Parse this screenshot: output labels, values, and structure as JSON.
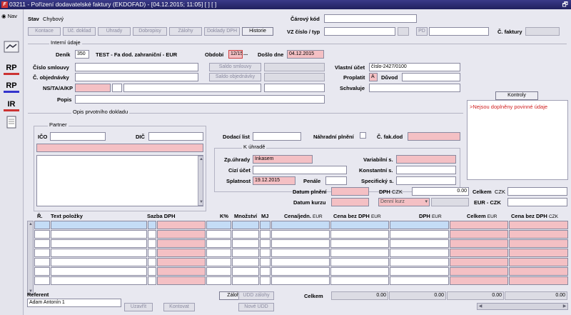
{
  "window": {
    "title": "03211 - Pořízení dodavatelské faktury (EKDOFAD) - [04.12.2015; 11:05] [ ] [ ]",
    "app_icon": "F"
  },
  "sidebar": {
    "nav_label": "Nav",
    "icons": [
      "handshake-icon",
      "RP",
      "RP",
      "IR",
      "document-icon"
    ]
  },
  "header": {
    "stav_label": "Stav",
    "stav_value": "Chybový",
    "carovy_kod_label": "Čárový kód",
    "carovy_kod_value": "",
    "vz_label": "VZ číslo / typ",
    "vz_value": "",
    "vz_typ": "",
    "pd_label": "PD",
    "pd_value": "",
    "c_faktury_label": "Č. faktury",
    "c_faktury_value": "",
    "buttons": [
      "Kontace",
      "Úč. doklad",
      "Úhrady",
      "Dobropisy",
      "Zálohy",
      "Doklady DPH",
      "Historie"
    ]
  },
  "interni": {
    "title": "Interní údaje",
    "denik_label": "Deník",
    "denik_value": "350",
    "denik_name": "TEST - Fa dod. zahraniční - EUR",
    "obdobi_label": "Období",
    "obdobi_value": "12/15",
    "obdobi_dots": "...",
    "doslo_label": "Došlo dne",
    "doslo_value": "04.12.2015",
    "cislo_smlouvy_label": "Číslo smlouvy",
    "cislo_smlouvy_value": "",
    "saldo_smlouvy_btn": "Saldo smlouvy",
    "saldo_smlouvy_value": "",
    "c_objednavky_label": "Č. objednávky",
    "c_objednavky_value": "",
    "saldo_objednavky_btn": "Saldo objednávky",
    "saldo_objednavky_value": "",
    "ns_label": "NS/TA/A/KP",
    "popis_label": "Popis",
    "popis_value": "",
    "vlastni_ucet_label": "Vlastní účet",
    "vlastni_ucet_value": "číslo-2427/0100",
    "proplatit_label": "Proplatit",
    "proplatit_value": "A",
    "duvod_label": "Důvod",
    "duvod_value": "",
    "schvaluje_label": "Schvaluje",
    "schvaluje_value": ""
  },
  "kontroly": {
    "button": "Kontroly",
    "message": ">Nejsou doplněny povinné údaje"
  },
  "opis": {
    "title": "Opis prvotního dokladu",
    "partner_title": "Partner",
    "ico_label": "IČO",
    "ico_value": "",
    "dic_label": "DIČ",
    "dic_value": "",
    "dodaci_list_label": "Dodací list",
    "dodaci_list_value": "",
    "nahradni_plneni_label": "Náhradní plnění",
    "c_fak_dod_label": "Č. fak.dod",
    "c_fak_dod_value": "",
    "k_uhrade_title": "K úhradě",
    "zp_uhrady_label": "Zp.úhrady",
    "zp_uhrady_value": "Inkasem",
    "cizi_ucet_label": "Cizí účet",
    "cizi_ucet_value": "",
    "splatnost_label": "Splatnost",
    "splatnost_value": "19.12.2015",
    "penale_label": "Penále",
    "penale_value": "",
    "variabilni_label": "Variabilní s.",
    "variabilni_value": "",
    "konstantni_label": "Konstantní s.",
    "konstantni_value": "",
    "specificky_label": "Specifický s.",
    "specificky_value": ""
  },
  "datumy": {
    "plneni_label": "Datum plnění",
    "plneni_value": "",
    "kurzu_label": "Datum kurzu",
    "kurzu_value": "",
    "dph_label": "DPH",
    "dph_currency": "CZK",
    "dph_value": "0.00",
    "denni_kurz": "Denní kurz",
    "celkem_label": "Celkem",
    "celkem_currency": "CZK",
    "celkem_value": "",
    "eur_czk_label": "EUR - CZK",
    "eur_czk_value": ""
  },
  "grid": {
    "columns": [
      "Ř.",
      "Text položky",
      "Sazba DPH",
      "K%",
      "Množství",
      "MJ",
      "Cena/jedn.",
      "Cena bez DPH",
      "DPH",
      "Celkem",
      "Cena bez DPH"
    ],
    "units": [
      "",
      "",
      "",
      "",
      "",
      "",
      "EUR",
      "EUR",
      "EUR",
      "EUR",
      "CZK"
    ],
    "row_count": 7
  },
  "footer": {
    "referent_label": "Referent",
    "referent_value": "Adam Antonín 1",
    "uzavrit_btn": "Uzavřít",
    "kontovat_btn": "Kontovat",
    "zaloha_btn": "Záloha",
    "udd_zalohy_btn": "UDD zálohy",
    "nove_udd_btn": "Nové UDD",
    "celkem_label": "Celkem",
    "totals": [
      "0.00",
      "0.00",
      "0.00",
      "0.00",
      "0.00"
    ]
  }
}
